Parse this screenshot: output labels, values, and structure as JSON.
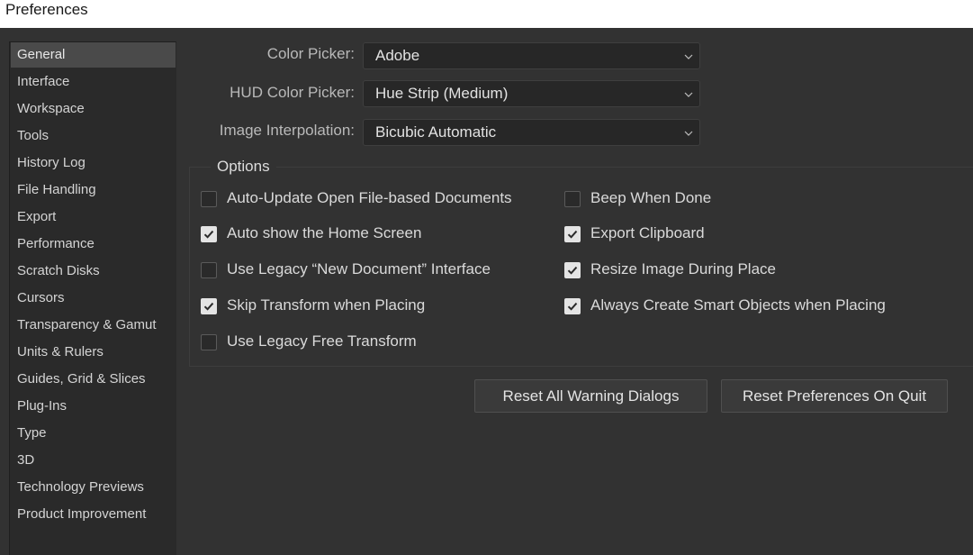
{
  "window": {
    "title": "Preferences"
  },
  "sidebar": {
    "selected": "General",
    "items": [
      {
        "label": "General"
      },
      {
        "label": "Interface"
      },
      {
        "label": "Workspace"
      },
      {
        "label": "Tools"
      },
      {
        "label": "History Log"
      },
      {
        "label": "File Handling"
      },
      {
        "label": "Export"
      },
      {
        "label": "Performance"
      },
      {
        "label": "Scratch Disks"
      },
      {
        "label": "Cursors"
      },
      {
        "label": "Transparency & Gamut"
      },
      {
        "label": "Units & Rulers"
      },
      {
        "label": "Guides, Grid & Slices"
      },
      {
        "label": "Plug-Ins"
      },
      {
        "label": "Type"
      },
      {
        "label": "3D"
      },
      {
        "label": "Technology Previews"
      },
      {
        "label": "Product Improvement"
      }
    ]
  },
  "general": {
    "color_picker": {
      "label": "Color Picker:",
      "value": "Adobe"
    },
    "hud_color_picker": {
      "label": "HUD Color Picker:",
      "value": "Hue Strip (Medium)"
    },
    "image_interpolation": {
      "label": "Image Interpolation:",
      "value": "Bicubic Automatic"
    }
  },
  "options": {
    "title": "Options",
    "left": [
      {
        "label": "Auto-Update Open File-based Documents",
        "checked": false
      },
      {
        "label": "Auto show the Home Screen",
        "checked": true
      },
      {
        "label": "Use Legacy “New Document” Interface",
        "checked": false
      },
      {
        "label": "Skip Transform when Placing",
        "checked": true
      },
      {
        "label": "Use Legacy Free Transform",
        "checked": false
      }
    ],
    "right": [
      {
        "label": "Beep When Done",
        "checked": false
      },
      {
        "label": "Export Clipboard",
        "checked": true
      },
      {
        "label": "Resize Image During Place",
        "checked": true
      },
      {
        "label": "Always Create Smart Objects when Placing",
        "checked": true
      }
    ]
  },
  "buttons": {
    "reset_warnings": "Reset All Warning Dialogs",
    "reset_prefs": "Reset Preferences On Quit"
  },
  "icons": {
    "dropdown": "chevron-down-icon",
    "check": "checkmark-icon"
  },
  "colors": {
    "background": "#323232",
    "sidebar": "#2a2a2a",
    "selected": "#4a4a4a",
    "field": "#272727",
    "text": "#d6d6d6"
  }
}
